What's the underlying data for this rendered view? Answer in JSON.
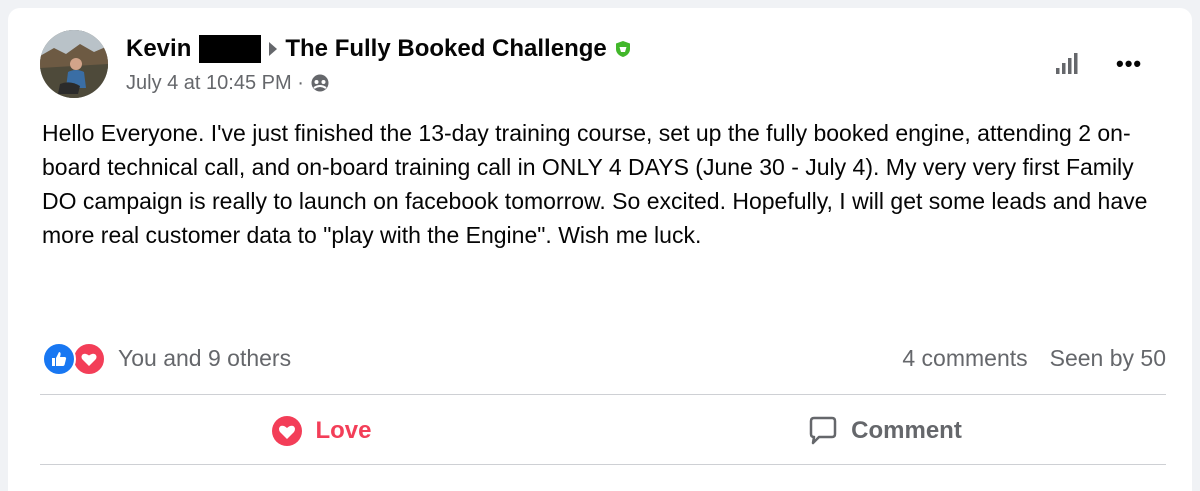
{
  "post": {
    "author": "Kevin",
    "group": "The Fully Booked Challenge",
    "timestamp": "July 4 at 10:45 PM ·",
    "body": "Hello Everyone. I've just finished the 13-day training course, set up the fully booked engine, attending 2 on-board technical call, and on-board training call in ONLY 4 DAYS (June 30 - July 4). My very very first Family DO campaign is really to launch on facebook tomorrow. So excited. Hopefully, I will get some leads and have more real customer data to \"play with the Engine\". Wish me luck."
  },
  "footer": {
    "reactions_text": "You and 9 others",
    "comments_text": "4 comments",
    "seen_text": "Seen by 50"
  },
  "actions": {
    "love_label": "Love",
    "comment_label": "Comment"
  },
  "icons": {
    "header": [
      "caret-right-icon",
      "shield-badge-icon",
      "group-privacy-icon",
      "insights-icon",
      "more-options-icon"
    ],
    "reactions": [
      "like-reaction-icon",
      "love-reaction-icon"
    ],
    "actions": [
      "heart-icon",
      "comment-icon"
    ]
  },
  "colors": {
    "love": "#f33e58",
    "like": "#1877f2",
    "badge": "#42b72a",
    "muted": "#65676b"
  }
}
